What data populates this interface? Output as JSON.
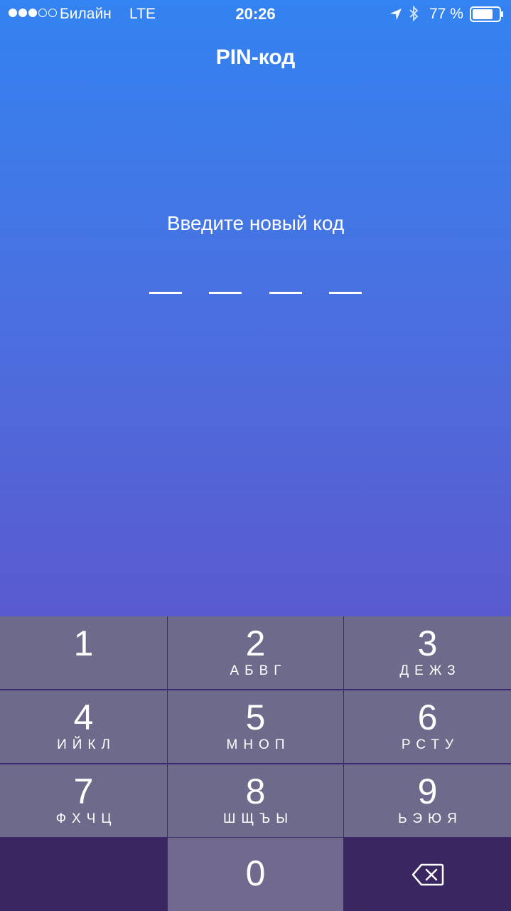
{
  "status_bar": {
    "carrier": "Билайн",
    "network": "LTE",
    "time": "20:26",
    "battery_percent": "77 %",
    "signal_bars_filled": 3,
    "signal_bars_total": 5,
    "battery_level": 0.77
  },
  "nav": {
    "title": "PIN-код"
  },
  "prompt": "Введите новый код",
  "pin_length": 4,
  "keypad": {
    "keys": [
      {
        "digit": "1",
        "letters": ""
      },
      {
        "digit": "2",
        "letters": "АБВГ"
      },
      {
        "digit": "3",
        "letters": "ДЕЖЗ"
      },
      {
        "digit": "4",
        "letters": "ИЙКЛ"
      },
      {
        "digit": "5",
        "letters": "МНОП"
      },
      {
        "digit": "6",
        "letters": "РСТУ"
      },
      {
        "digit": "7",
        "letters": "ФХЧЦ"
      },
      {
        "digit": "8",
        "letters": "ШЩЪЫ"
      },
      {
        "digit": "9",
        "letters": "ЬЭЮЯ"
      },
      {
        "digit": "0",
        "letters": ""
      }
    ],
    "delete_icon": "backspace-icon"
  },
  "colors": {
    "gradient_top": "#3383f1",
    "gradient_bottom": "#5a5acf",
    "key_bg": "#6d6a8c",
    "key_dark_bg": "#3a2660"
  }
}
